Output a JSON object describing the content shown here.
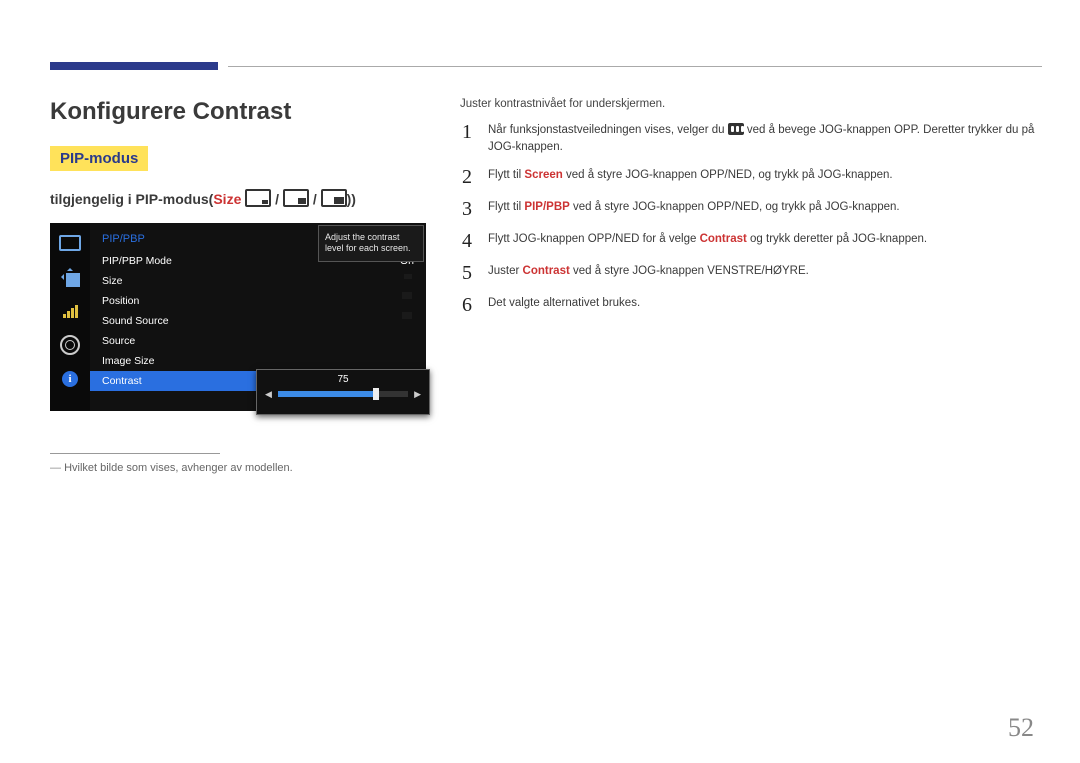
{
  "header": {
    "title": "Konfigurere Contrast"
  },
  "mode_badge": "PIP-modus",
  "subtitle": {
    "prefix": "tilgjengelig i PIP-modus(",
    "size_word": "Size",
    "suffix": "))"
  },
  "osd": {
    "header": "PIP/PBP",
    "rows": [
      {
        "label": "PIP/PBP Mode",
        "value": "On",
        "selected": false,
        "pict": null
      },
      {
        "label": "Size",
        "value": "",
        "selected": false,
        "pict": "a"
      },
      {
        "label": "Position",
        "value": "",
        "selected": false,
        "pict": "b"
      },
      {
        "label": "Sound Source",
        "value": "",
        "selected": false,
        "pict": "b"
      },
      {
        "label": "Source",
        "value": "",
        "selected": false,
        "pict": null
      },
      {
        "label": "Image Size",
        "value": "",
        "selected": false,
        "pict": null
      },
      {
        "label": "Contrast",
        "value": "",
        "selected": true,
        "pict": null
      }
    ],
    "tooltip": "Adjust the contrast level for each screen.",
    "slider_value": "75"
  },
  "footnote": "Hvilket bilde som vises, avhenger av modellen.",
  "intro": "Juster kontrastnivået for underskjermen.",
  "steps": [
    {
      "num": "1",
      "segments": [
        {
          "t": "Når funksjonstastveiledningen vises, velger du "
        },
        {
          "glyph": true
        },
        {
          "t": " ved å bevege JOG-knappen OPP. Deretter trykker du på JOG-knappen."
        }
      ]
    },
    {
      "num": "2",
      "segments": [
        {
          "t": "Flytt til "
        },
        {
          "t": "Screen",
          "cls": "hl-red"
        },
        {
          "t": " ved å styre JOG-knappen OPP/NED, og trykk på JOG-knappen."
        }
      ]
    },
    {
      "num": "3",
      "segments": [
        {
          "t": "Flytt til "
        },
        {
          "t": "PIP/PBP",
          "cls": "hl-red"
        },
        {
          "t": " ved å styre JOG-knappen OPP/NED, og trykk på JOG-knappen."
        }
      ]
    },
    {
      "num": "4",
      "segments": [
        {
          "t": "Flytt JOG-knappen OPP/NED for å velge "
        },
        {
          "t": "Contrast",
          "cls": "hl-red"
        },
        {
          "t": " og trykk deretter på JOG-knappen."
        }
      ]
    },
    {
      "num": "5",
      "segments": [
        {
          "t": "Juster "
        },
        {
          "t": "Contrast",
          "cls": "hl-red"
        },
        {
          "t": " ved å styre JOG-knappen VENSTRE/HØYRE."
        }
      ]
    },
    {
      "num": "6",
      "segments": [
        {
          "t": "Det valgte alternativet brukes."
        }
      ]
    }
  ],
  "page_number": "52"
}
